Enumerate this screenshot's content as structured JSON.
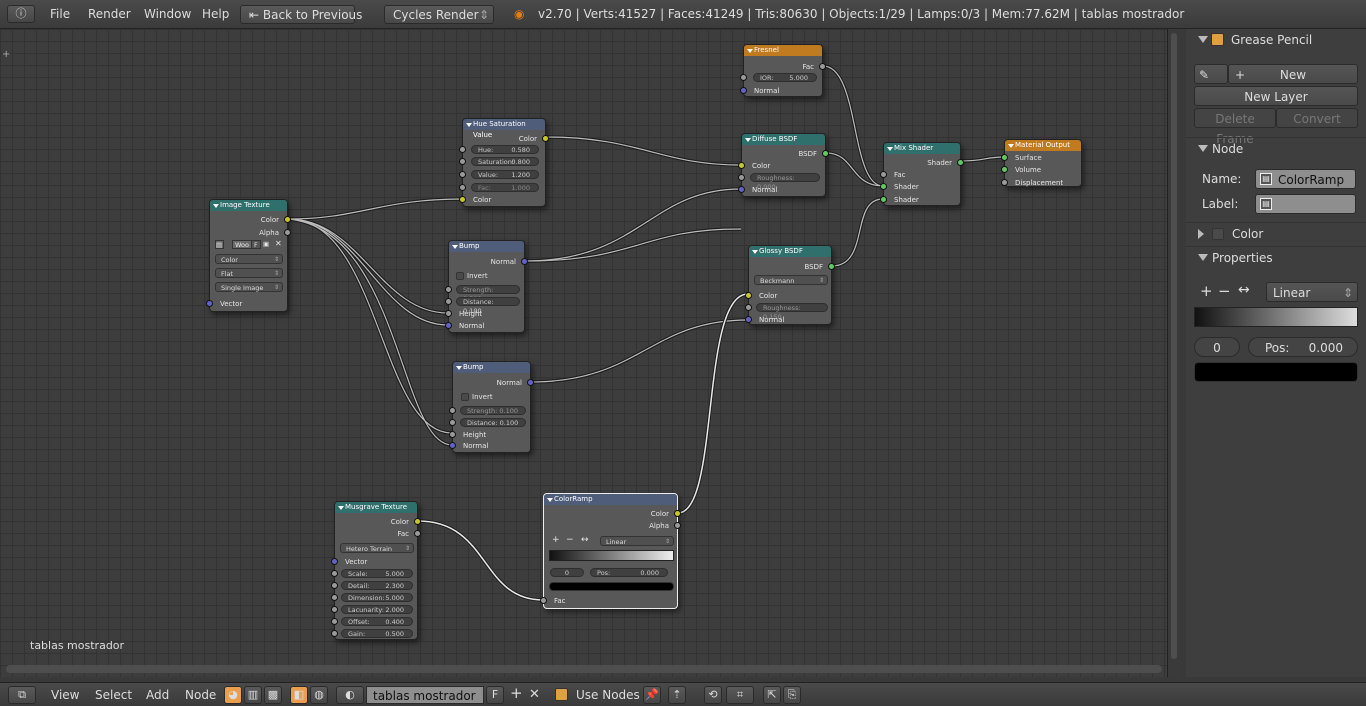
{
  "topbar": {
    "menus": [
      "File",
      "Render",
      "Window",
      "Help"
    ],
    "back_button": "Back to Previous",
    "engine": "Cycles Render",
    "stats": "v2.70 | Verts:41527 | Faces:41249 | Tris:80630 | Objects:1/29 | Lamps:0/3 | Mem:77.62M | tablas mostrador"
  },
  "editor": {
    "material_label": "tablas mostrador",
    "nodes": {
      "fresnel": {
        "title": "Fresnel",
        "out_fac": "Fac",
        "ior_label": "IOR:",
        "ior_value": "5.000",
        "normal": "Normal"
      },
      "hsv": {
        "title": "Hue Saturation Value",
        "out_color": "Color",
        "hue_label": "Hue:",
        "hue": "0.580",
        "sat_label": "Saturation:",
        "sat": "0.800",
        "val_label": "Value:",
        "val": "1.200",
        "fac_label": "Fac:",
        "fac": "1.000",
        "in_color": "Color"
      },
      "diffuse": {
        "title": "Diffuse BSDF",
        "out": "BSDF",
        "color": "Color",
        "roughness": "Roughness: 0.000",
        "normal": "Normal"
      },
      "mix": {
        "title": "Mix Shader",
        "out": "Shader",
        "fac": "Fac",
        "shader1": "Shader",
        "shader2": "Shader"
      },
      "output": {
        "title": "Material Output",
        "surface": "Surface",
        "volume": "Volume",
        "displacement": "Displacement"
      },
      "image": {
        "title": "Image Texture",
        "out_color": "Color",
        "out_alpha": "Alpha",
        "img_name": "Woo",
        "img_f": "F",
        "color_mode": "Color",
        "projection": "Flat",
        "source": "Single Image",
        "vector": "Vector"
      },
      "bump1": {
        "title": "Bump",
        "out": "Normal",
        "invert": "Invert",
        "strength": "Strength: 0.300",
        "distance": "Distance: 0.100",
        "height": "Height",
        "normal": "Normal"
      },
      "glossy": {
        "title": "Glossy BSDF",
        "out": "BSDF",
        "dist": "Beckmann",
        "color": "Color",
        "roughness": "Roughness: 0.150",
        "normal": "Normal"
      },
      "bump2": {
        "title": "Bump",
        "out": "Normal",
        "invert": "Invert",
        "strength": "Strength: 0.100",
        "distance": "Distance: 0.100",
        "height": "Height",
        "normal": "Normal"
      },
      "musgrave": {
        "title": "Musgrave Texture",
        "out_color": "Color",
        "out_fac": "Fac",
        "type": "Hetero Terrain",
        "vector": "Vector",
        "scale_l": "Scale:",
        "scale": "5.000",
        "detail_l": "Detail:",
        "detail": "2.300",
        "dim_l": "Dimension:",
        "dim": "5.000",
        "lac_l": "Lacunarity:",
        "lac": "2.000",
        "off_l": "Offset:",
        "off": "0.400",
        "gain_l": "Gain:",
        "gain": "0.500"
      },
      "ramp": {
        "title": "ColorRamp",
        "out_color": "Color",
        "out_alpha": "Alpha",
        "interp": "Linear",
        "index": "0",
        "pos_label": "Pos:",
        "pos": "0.000",
        "fac": "Fac"
      }
    }
  },
  "panel": {
    "grease_pencil": "Grease Pencil",
    "new": "New",
    "new_layer": "New Layer",
    "delete_frame": "Delete Frame",
    "convert": "Convert",
    "node_section": "Node",
    "name_label": "Name:",
    "name_value": "ColorRamp",
    "label_label": "Label:",
    "color_section": "Color",
    "properties_section": "Properties",
    "interp": "Linear",
    "index": "0",
    "pos_label": "Pos:",
    "pos": "0.000"
  },
  "bottombar": {
    "menus": [
      "View",
      "Select",
      "Add",
      "Node"
    ],
    "material": "tablas mostrador",
    "fake_user": "F",
    "use_nodes": "Use Nodes"
  }
}
